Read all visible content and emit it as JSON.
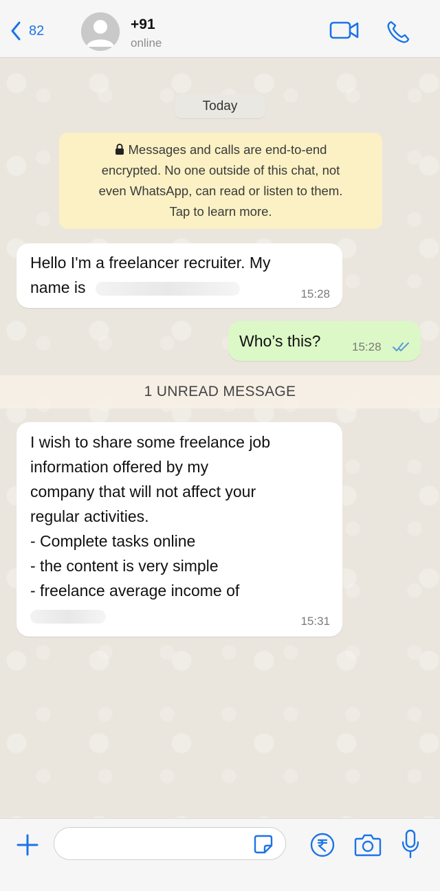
{
  "header": {
    "back_count": "82",
    "contact_name": "+91",
    "status": "online",
    "icons": {
      "back": "chevron-left-icon",
      "video": "video-camera-icon",
      "call": "phone-icon"
    },
    "accent_color": "#1a73e8"
  },
  "chat": {
    "date_label": "Today",
    "encryption_notice": {
      "line1": "Messages and calls are end-to-end",
      "line2": "encrypted. No one outside of this chat, not",
      "line3": "even WhatsApp, can read or listen to them.",
      "line4": "Tap to learn more."
    },
    "messages": [
      {
        "direction": "incoming",
        "line1": "Hello I'm a freelancer recruiter. My",
        "line2": "name is",
        "time": "15:28"
      },
      {
        "direction": "outgoing",
        "text": "Who’s this?",
        "time": "15:28",
        "status_icon": "double-tick-icon"
      },
      {
        "direction": "incoming",
        "lines": [
          "I wish to share some freelance job",
          "information offered by my",
          "company that will not affect your",
          "regular activities.",
          "- Complete tasks online",
          "- the content is very simple",
          "- freelance average income of"
        ],
        "time": "15:31"
      }
    ],
    "unread_label": "1 UNREAD MESSAGE",
    "bubble_colors": {
      "incoming": "#ffffff",
      "outgoing": "#dcf8c6",
      "notice": "#fbf1c4"
    }
  },
  "composer": {
    "input_value": "",
    "icons": {
      "attach": "plus-icon",
      "sticker": "sticker-icon",
      "payment": "rupee-icon",
      "camera": "camera-icon",
      "voice": "microphone-icon"
    }
  }
}
